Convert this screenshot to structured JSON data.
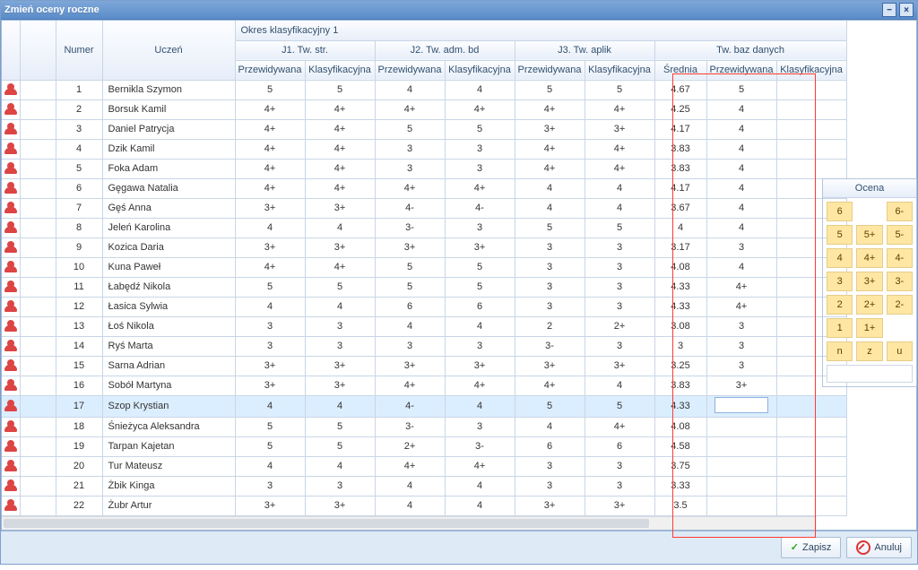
{
  "title": "Zmień oceny roczne",
  "super_header": "Okres klasyfikacyjny 1",
  "group_headers": [
    "J1. Tw. str.",
    "J2. Tw. adm. bd",
    "J3. Tw. aplik",
    "Tw. baz danych"
  ],
  "col_headers": {
    "numer": "Numer",
    "uczen": "Uczeń",
    "przewidywana": "Przewidywana",
    "klasyfikacyjna": "Klasyfikacyjna",
    "srednia": "Średnia"
  },
  "students": [
    {
      "num": 1,
      "name": "Bernikla Szymon",
      "j1p": "5",
      "j1k": "5",
      "j2p": "4",
      "j2k": "4",
      "j3p": "5",
      "j3k": "5",
      "avg": "4.67",
      "dbp": "5",
      "dbk": ""
    },
    {
      "num": 2,
      "name": "Borsuk Kamil",
      "j1p": "4+",
      "j1k": "4+",
      "j2p": "4+",
      "j2k": "4+",
      "j3p": "4+",
      "j3k": "4+",
      "avg": "4.25",
      "dbp": "4",
      "dbk": ""
    },
    {
      "num": 3,
      "name": "Daniel Patrycja",
      "j1p": "4+",
      "j1k": "4+",
      "j2p": "5",
      "j2k": "5",
      "j3p": "3+",
      "j3k": "3+",
      "avg": "4.17",
      "dbp": "4",
      "dbk": ""
    },
    {
      "num": 4,
      "name": "Dzik Kamil",
      "j1p": "4+",
      "j1k": "4+",
      "j2p": "3",
      "j2k": "3",
      "j3p": "4+",
      "j3k": "4+",
      "avg": "3.83",
      "dbp": "4",
      "dbk": ""
    },
    {
      "num": 5,
      "name": "Foka Adam",
      "j1p": "4+",
      "j1k": "4+",
      "j2p": "3",
      "j2k": "3",
      "j3p": "4+",
      "j3k": "4+",
      "avg": "3.83",
      "dbp": "4",
      "dbk": ""
    },
    {
      "num": 6,
      "name": "Gęgawa Natalia",
      "j1p": "4+",
      "j1k": "4+",
      "j2p": "4+",
      "j2k": "4+",
      "j3p": "4",
      "j3k": "4",
      "avg": "4.17",
      "dbp": "4",
      "dbk": ""
    },
    {
      "num": 7,
      "name": "Gęś Anna",
      "j1p": "3+",
      "j1k": "3+",
      "j2p": "4-",
      "j2k": "4-",
      "j3p": "4",
      "j3k": "4",
      "avg": "3.67",
      "dbp": "4",
      "dbk": ""
    },
    {
      "num": 8,
      "name": "Jeleń Karolina",
      "j1p": "4",
      "j1k": "4",
      "j2p": "3-",
      "j2k": "3",
      "j3p": "5",
      "j3k": "5",
      "avg": "4",
      "dbp": "4",
      "dbk": ""
    },
    {
      "num": 9,
      "name": "Kozica Daria",
      "j1p": "3+",
      "j1k": "3+",
      "j2p": "3+",
      "j2k": "3+",
      "j3p": "3",
      "j3k": "3",
      "avg": "3.17",
      "dbp": "3",
      "dbk": ""
    },
    {
      "num": 10,
      "name": "Kuna Paweł",
      "j1p": "4+",
      "j1k": "4+",
      "j2p": "5",
      "j2k": "5",
      "j3p": "3",
      "j3k": "3",
      "avg": "4.08",
      "dbp": "4",
      "dbk": ""
    },
    {
      "num": 11,
      "name": "Łabędź Nikola",
      "j1p": "5",
      "j1k": "5",
      "j2p": "5",
      "j2k": "5",
      "j3p": "3",
      "j3k": "3",
      "avg": "4.33",
      "dbp": "4+",
      "dbk": ""
    },
    {
      "num": 12,
      "name": "Łasica Sylwia",
      "j1p": "4",
      "j1k": "4",
      "j2p": "6",
      "j2k": "6",
      "j3p": "3",
      "j3k": "3",
      "avg": "4.33",
      "dbp": "4+",
      "dbk": ""
    },
    {
      "num": 13,
      "name": "Łoś Nikola",
      "j1p": "3",
      "j1k": "3",
      "j2p": "4",
      "j2k": "4",
      "j3p": "2",
      "j3k": "2+",
      "avg": "3.08",
      "dbp": "3",
      "dbk": ""
    },
    {
      "num": 14,
      "name": "Ryś Marta",
      "j1p": "3",
      "j1k": "3",
      "j2p": "3",
      "j2k": "3",
      "j3p": "3-",
      "j3k": "3",
      "avg": "3",
      "dbp": "3",
      "dbk": ""
    },
    {
      "num": 15,
      "name": "Sarna Adrian",
      "j1p": "3+",
      "j1k": "3+",
      "j2p": "3+",
      "j2k": "3+",
      "j3p": "3+",
      "j3k": "3+",
      "avg": "3.25",
      "dbp": "3",
      "dbk": ""
    },
    {
      "num": 16,
      "name": "Sobół Martyna",
      "j1p": "3+",
      "j1k": "3+",
      "j2p": "4+",
      "j2k": "4+",
      "j3p": "4+",
      "j3k": "4",
      "avg": "3.83",
      "dbp": "3+",
      "dbk": ""
    },
    {
      "num": 17,
      "name": "Szop Krystian",
      "j1p": "4",
      "j1k": "4",
      "j2p": "4-",
      "j2k": "4",
      "j3p": "5",
      "j3k": "5",
      "avg": "4.33",
      "dbp": "",
      "dbk": "",
      "selected": true
    },
    {
      "num": 18,
      "name": "Śnieżyca Aleksandra",
      "j1p": "5",
      "j1k": "5",
      "j2p": "3-",
      "j2k": "3",
      "j3p": "4",
      "j3k": "4+",
      "avg": "4.08",
      "dbp": "",
      "dbk": ""
    },
    {
      "num": 19,
      "name": "Tarpan Kajetan",
      "j1p": "5",
      "j1k": "5",
      "j2p": "2+",
      "j2k": "3-",
      "j3p": "6",
      "j3k": "6",
      "avg": "4.58",
      "dbp": "",
      "dbk": ""
    },
    {
      "num": 20,
      "name": "Tur Mateusz",
      "j1p": "4",
      "j1k": "4",
      "j2p": "4+",
      "j2k": "4+",
      "j3p": "3",
      "j3k": "3",
      "avg": "3.75",
      "dbp": "",
      "dbk": ""
    },
    {
      "num": 21,
      "name": "Żbik Kinga",
      "j1p": "3",
      "j1k": "3",
      "j2p": "4",
      "j2k": "4",
      "j3p": "3",
      "j3k": "3",
      "avg": "3.33",
      "dbp": "",
      "dbk": ""
    },
    {
      "num": 22,
      "name": "Żubr Artur",
      "j1p": "3+",
      "j1k": "3+",
      "j2p": "4",
      "j2k": "4",
      "j3p": "3+",
      "j3k": "3+",
      "avg": "3.5",
      "dbp": "",
      "dbk": ""
    }
  ],
  "grade_panel": {
    "title": "Ocena",
    "buttons": [
      "6",
      "",
      "6-",
      "5",
      "5+",
      "5-",
      "4",
      "4+",
      "4-",
      "3",
      "3+",
      "3-",
      "2",
      "2+",
      "2-",
      "1",
      "1+",
      "",
      "n",
      "z",
      "u"
    ]
  },
  "footer": {
    "save": "Zapisz",
    "cancel": "Anuluj"
  }
}
